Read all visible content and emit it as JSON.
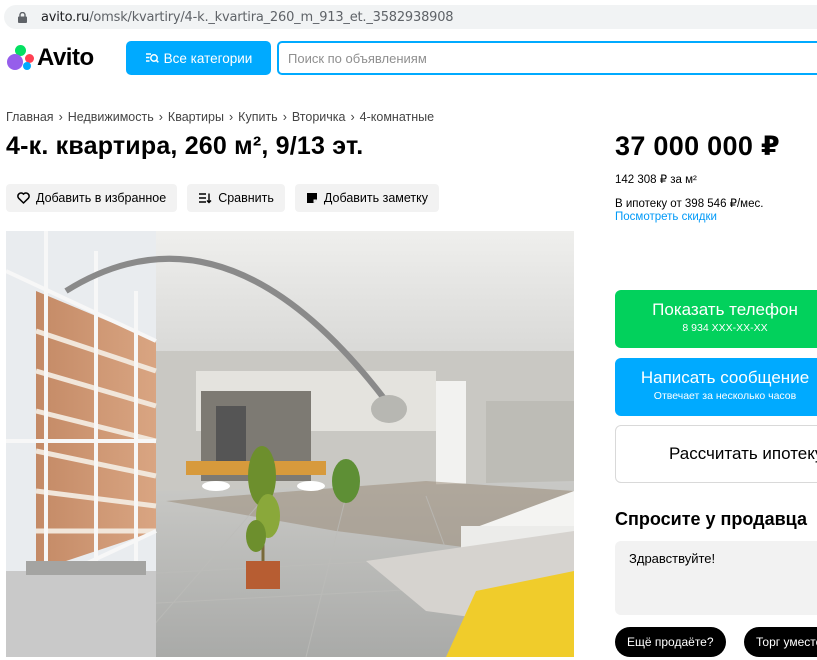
{
  "browser": {
    "url_domain": "avito.ru",
    "url_path": "/omsk/kvartiry/4-k._kvartira_260_m_913_et._3582938908"
  },
  "header": {
    "logo_text": "Avito",
    "categories_label": "Все категории",
    "search_placeholder": "Поиск по объявлениям"
  },
  "breadcrumbs": [
    "Главная",
    "Недвижимость",
    "Квартиры",
    "Купить",
    "Вторичка",
    "4-комнатные"
  ],
  "listing": {
    "title": "4-к. квартира, 260 м², 9/13 эт.",
    "actions": {
      "favorite": "Добавить в избранное",
      "compare": "Сравнить",
      "note": "Добавить заметку"
    }
  },
  "sidebar": {
    "price": "37 000 000 ₽",
    "price_per_m2": "142 308 ₽ за м²",
    "mortgage": "В ипотеку от 398 546 ₽/мес.",
    "discounts_link": "Посмотреть скидки",
    "phone_button": "Показать телефон",
    "phone_masked": "8 934 XXX-XX-XX",
    "message_button": "Написать сообщение",
    "message_sub": "Отвечает за несколько часов",
    "calc_button": "Рассчитать ипотеку",
    "ask_title": "Спросите у продавца",
    "ask_text": "Здравствуйте!",
    "quick_replies": [
      "Ещё продаёте?",
      "Торг уместен?"
    ]
  },
  "colors": {
    "brand_blue": "#00aaff",
    "green": "#02d15c",
    "link": "#0099f7"
  }
}
